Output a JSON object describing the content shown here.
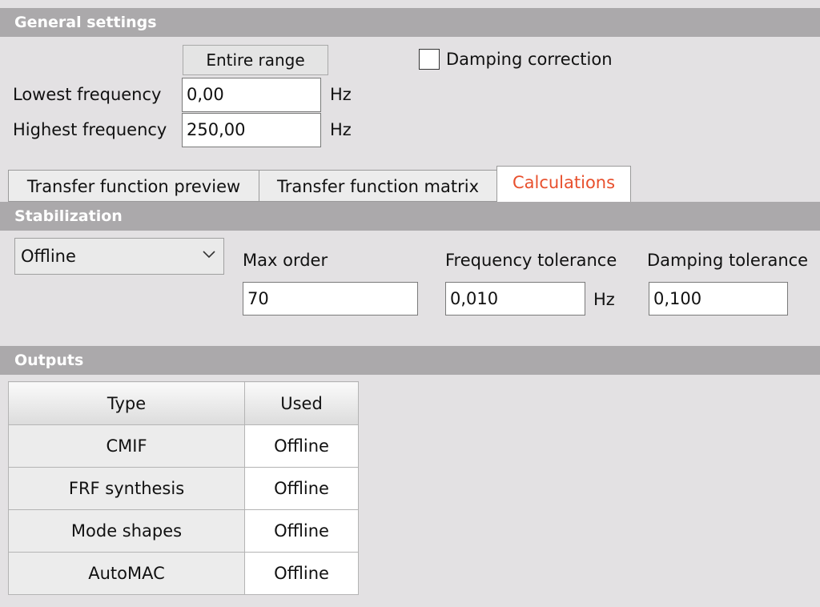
{
  "general": {
    "header": "General settings",
    "entire_range_label": "Entire range",
    "damping_correction_label": "Damping correction",
    "damping_correction_checked": false,
    "lowest_frequency_label": "Lowest frequency",
    "lowest_frequency_value": "0,00",
    "highest_frequency_label": "Highest frequency",
    "highest_frequency_value": "250,00",
    "unit": "Hz"
  },
  "tabs": [
    {
      "label": "Transfer function preview",
      "active": false
    },
    {
      "label": "Transfer function matrix",
      "active": false
    },
    {
      "label": "Calculations",
      "active": true
    }
  ],
  "stabilization": {
    "header": "Stabilization",
    "mode_selected": "Offline",
    "max_order_label": "Max order",
    "max_order_value": "70",
    "frequency_tolerance_label": "Frequency tolerance",
    "frequency_tolerance_value": "0,010",
    "frequency_tolerance_unit": "Hz",
    "damping_tolerance_label": "Damping tolerance",
    "damping_tolerance_value": "0,100"
  },
  "outputs": {
    "header": "Outputs",
    "columns": [
      "Type",
      "Used"
    ],
    "rows": [
      {
        "type": "CMIF",
        "used": "Offline"
      },
      {
        "type": "FRF synthesis",
        "used": "Offline"
      },
      {
        "type": "Mode shapes",
        "used": "Offline"
      },
      {
        "type": "AutoMAC",
        "used": "Offline"
      }
    ]
  },
  "colors": {
    "active_tab_text": "#e8502d",
    "section_bar": "#aba9ab",
    "panel_bg": "#e3e1e3"
  },
  "icons": {
    "dropdown": "chevron-down-icon"
  }
}
